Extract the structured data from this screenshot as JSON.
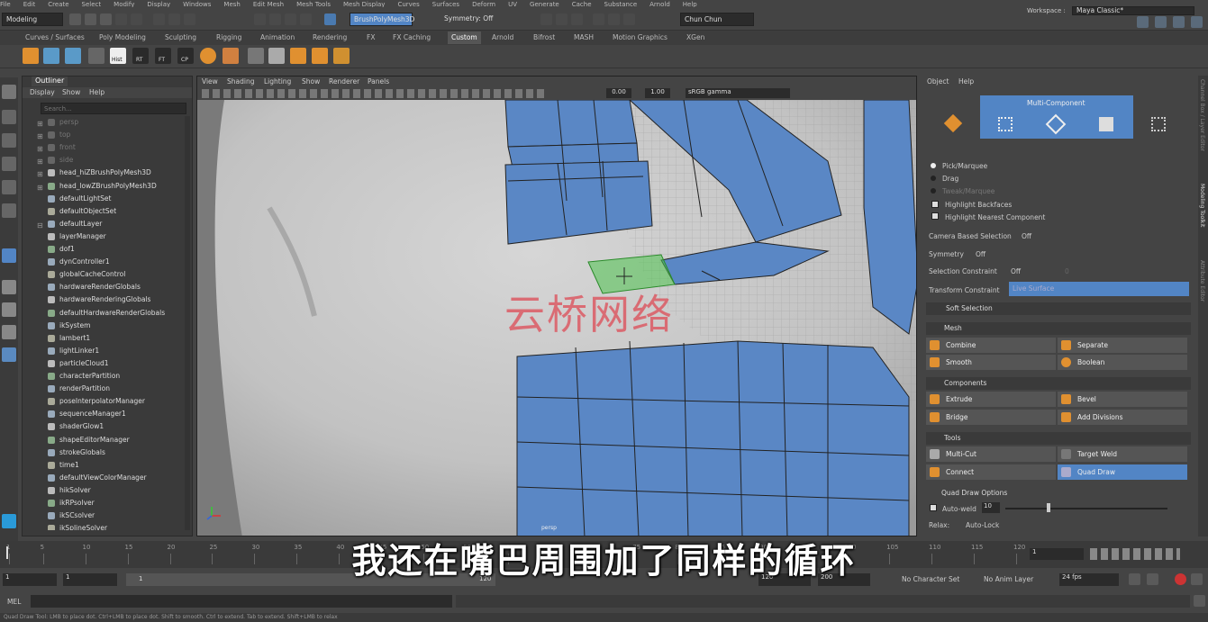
{
  "menu": [
    "File",
    "Edit",
    "Create",
    "Select",
    "Modify",
    "Display",
    "Windows",
    "Mesh",
    "Edit Mesh",
    "Mesh Tools",
    "Mesh Display",
    "Curves",
    "Surfaces",
    "Deform",
    "UV",
    "Generate",
    "Cache",
    "Substance",
    "Arnold",
    "Help"
  ],
  "status": {
    "mode": "Modeling",
    "object_field": "BrushPolyMesh3D",
    "symmetry": "Symmetry: Off",
    "user": "Chun Chun",
    "workspace_label": "Workspace :",
    "workspace": "Maya Classic*"
  },
  "shelf_tabs": [
    "Curves / Surfaces",
    "Poly Modeling",
    "Sculpting",
    "Rigging",
    "Animation",
    "Rendering",
    "FX",
    "FX Caching",
    "Custom",
    "Arnold",
    "Bifrost",
    "MASH",
    "Motion Graphics",
    "XGen"
  ],
  "shelf_labels": [
    "Hist",
    "RT",
    "FT",
    "CP"
  ],
  "outliner": {
    "title": "Outliner",
    "menu": [
      "Display",
      "Show",
      "Help"
    ],
    "search_placeholder": "Search...",
    "items": [
      {
        "label": "persp",
        "dim": true,
        "exp": "+"
      },
      {
        "label": "top",
        "dim": true,
        "exp": "+"
      },
      {
        "label": "front",
        "dim": true,
        "exp": "+"
      },
      {
        "label": "side",
        "dim": true,
        "exp": "+"
      },
      {
        "label": "head_hiZBrushPolyMesh3D",
        "exp": "+"
      },
      {
        "label": "head_lowZBrushPolyMesh3D",
        "exp": "+"
      },
      {
        "label": "defaultLightSet"
      },
      {
        "label": "defaultObjectSet"
      },
      {
        "label": "defaultLayer",
        "exp": "-"
      },
      {
        "label": "layerManager"
      },
      {
        "label": "dof1"
      },
      {
        "label": "dynController1"
      },
      {
        "label": "globalCacheControl"
      },
      {
        "label": "hardwareRenderGlobals"
      },
      {
        "label": "hardwareRenderingGlobals"
      },
      {
        "label": "defaultHardwareRenderGlobals"
      },
      {
        "label": "ikSystem"
      },
      {
        "label": "lambert1"
      },
      {
        "label": "lightLinker1"
      },
      {
        "label": "particleCloud1"
      },
      {
        "label": "characterPartition"
      },
      {
        "label": "renderPartition"
      },
      {
        "label": "poseInterpolatorManager"
      },
      {
        "label": "sequenceManager1"
      },
      {
        "label": "shaderGlow1"
      },
      {
        "label": "shapeEditorManager"
      },
      {
        "label": "strokeGlobals"
      },
      {
        "label": "time1"
      },
      {
        "label": "defaultViewColorManager"
      },
      {
        "label": "hikSolver"
      },
      {
        "label": "ikRPsolver"
      },
      {
        "label": "ikSCsolver"
      },
      {
        "label": "ikSplineSolver"
      }
    ]
  },
  "viewport": {
    "menu": [
      "View",
      "Shading",
      "Lighting",
      "Show",
      "Renderer",
      "Panels"
    ],
    "exposure": "0.00",
    "gamma": "1.00",
    "colorspace": "sRGB gamma",
    "camera": "persp"
  },
  "modeling_toolkit": {
    "menu": [
      "Object",
      "Help"
    ],
    "multi_component": "Multi-Component",
    "selection": [
      "Pick/Marquee",
      "Drag",
      "Tweak/Marquee"
    ],
    "checks": [
      "Highlight Backfaces",
      "Highlight Nearest Component"
    ],
    "camera_based_selection": {
      "label": "Camera Based Selection",
      "value": "Off"
    },
    "symmetry": {
      "label": "Symmetry",
      "value": "Off"
    },
    "selection_constraint": {
      "label": "Selection Constraint",
      "value": "Off",
      "num": "0"
    },
    "transform_constraint": {
      "label": "Transform Constraint",
      "value": "Live Surface"
    },
    "soft_selection": "Soft Selection",
    "mesh": {
      "title": "Mesh",
      "buttons": [
        "Combine",
        "Separate",
        "Smooth",
        "Boolean"
      ]
    },
    "components": {
      "title": "Components",
      "buttons": [
        "Extrude",
        "Bevel",
        "Bridge",
        "Add Divisions"
      ]
    },
    "tools": {
      "title": "Tools",
      "buttons": [
        "Multi-Cut",
        "Target Weld",
        "Connect",
        "Quad Draw"
      ]
    },
    "quad_draw_options": {
      "title": "Quad Draw Options",
      "auto_weld_label": "Auto-weld",
      "auto_weld": "10",
      "relax_label": "Relax:",
      "relax": "Auto-Lock"
    }
  },
  "side_tabs": [
    "Channel Box / Layer Editor",
    "Modeling Toolkit",
    "Attribute Editor"
  ],
  "time_ticks": [
    "1",
    "5",
    "10",
    "15",
    "20",
    "25",
    "30",
    "35",
    "40",
    "45",
    "50",
    "55",
    "60",
    "65",
    "70",
    "75",
    "80",
    "85",
    "90",
    "95",
    "100",
    "105",
    "110",
    "115",
    "120"
  ],
  "time": {
    "current": "1",
    "start": "1",
    "range_start": "1",
    "range_field": "1",
    "range_end": "120",
    "end": "120",
    "anim_end": "200",
    "char_set": "No Character Set",
    "anim_layer": "No Anim Layer",
    "fps": "24 fps"
  },
  "cmd": {
    "label": "MEL"
  },
  "help_line": "Quad Draw Tool: LMB to place dot. Ctrl+LMB to place dot. Shift to smooth. Ctrl to extend. Tab to extend. Shift+LMB to relax",
  "watermark": "云桥网络",
  "subtitle": "我还在嘴巴周围加了同样的循环",
  "colors": {
    "accent": "#5285c5",
    "poly_blue": "#5a87c5",
    "selected_face": "#4cc24c"
  }
}
